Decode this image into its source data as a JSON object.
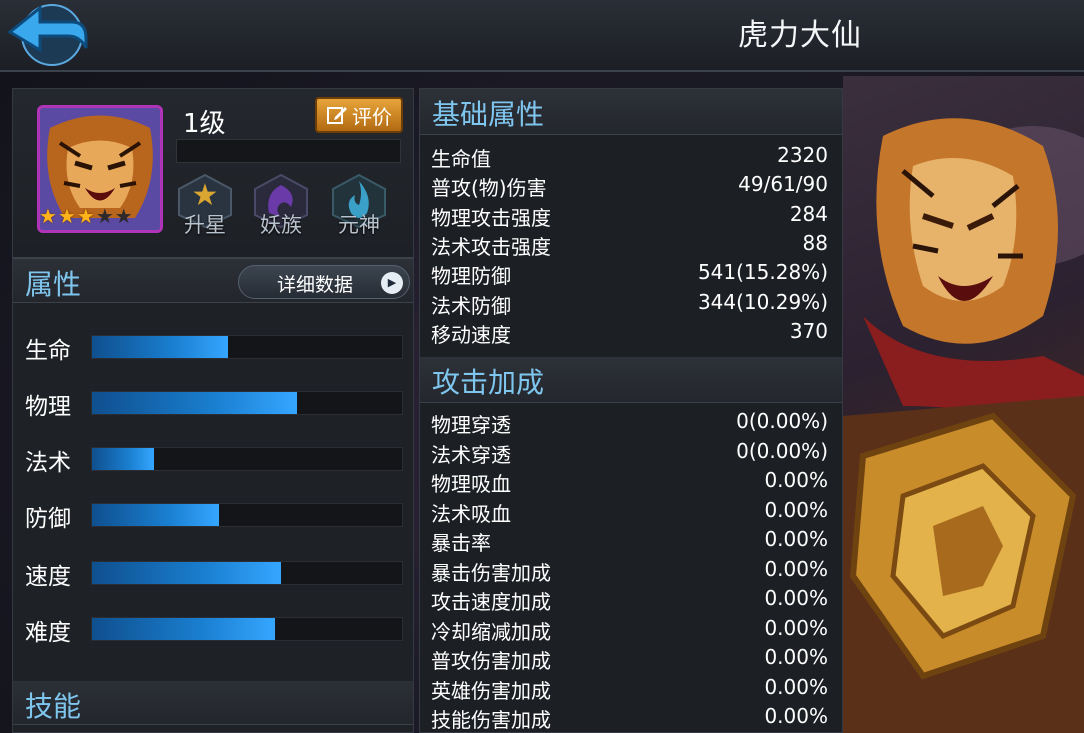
{
  "header": {
    "title": "虎力大仙"
  },
  "hero": {
    "level": "1级",
    "rate_button": "评价",
    "stars": [
      true,
      true,
      true,
      false,
      false
    ],
    "emblems": [
      {
        "label": "升星",
        "icon": "star-upgrade-icon"
      },
      {
        "label": "妖族",
        "icon": "demon-clan-icon"
      },
      {
        "label": "元神",
        "icon": "spirit-flame-icon"
      }
    ]
  },
  "attributes": {
    "title": "属性",
    "detail_button": "详细数据",
    "items": [
      {
        "label": "生命",
        "level_pct": 44
      },
      {
        "label": "物理",
        "level_pct": 66
      },
      {
        "label": "法术",
        "level_pct": 20
      },
      {
        "label": "防御",
        "level_pct": 41
      },
      {
        "label": "速度",
        "level_pct": 61
      },
      {
        "label": "难度",
        "level_pct": 59
      }
    ]
  },
  "skills": {
    "title": "技能"
  },
  "basic_stats": {
    "title": "基础属性",
    "items": [
      {
        "name": "生命值",
        "value": "2320"
      },
      {
        "name": "普攻(物)伤害",
        "value": "49/61/90"
      },
      {
        "name": "物理攻击强度",
        "value": "284"
      },
      {
        "name": "法术攻击强度",
        "value": "88"
      },
      {
        "name": "物理防御",
        "value": "541(15.28%)"
      },
      {
        "name": "法术防御",
        "value": "344(10.29%)"
      },
      {
        "name": "移动速度",
        "value": "370"
      }
    ]
  },
  "attack_bonus": {
    "title": "攻击加成",
    "items": [
      {
        "name": "物理穿透",
        "value": "0(0.00%)"
      },
      {
        "name": "法术穿透",
        "value": "0(0.00%)"
      },
      {
        "name": "物理吸血",
        "value": "0.00%"
      },
      {
        "name": "法术吸血",
        "value": "0.00%"
      },
      {
        "name": "暴击率",
        "value": "0.00%"
      },
      {
        "name": "暴击伤害加成",
        "value": "0.00%"
      },
      {
        "name": "攻击速度加成",
        "value": "0.00%"
      },
      {
        "name": "冷却缩减加成",
        "value": "0.00%"
      },
      {
        "name": "普攻伤害加成",
        "value": "0.00%"
      },
      {
        "name": "英雄伤害加成",
        "value": "0.00%"
      },
      {
        "name": "技能伤害加成",
        "value": "0.00%"
      }
    ]
  },
  "colors": {
    "accent": "#7fc6ef",
    "bar_fill": "#1a7fd0",
    "rate_button": "#e7a43a",
    "portrait_border": "#b034b8"
  }
}
